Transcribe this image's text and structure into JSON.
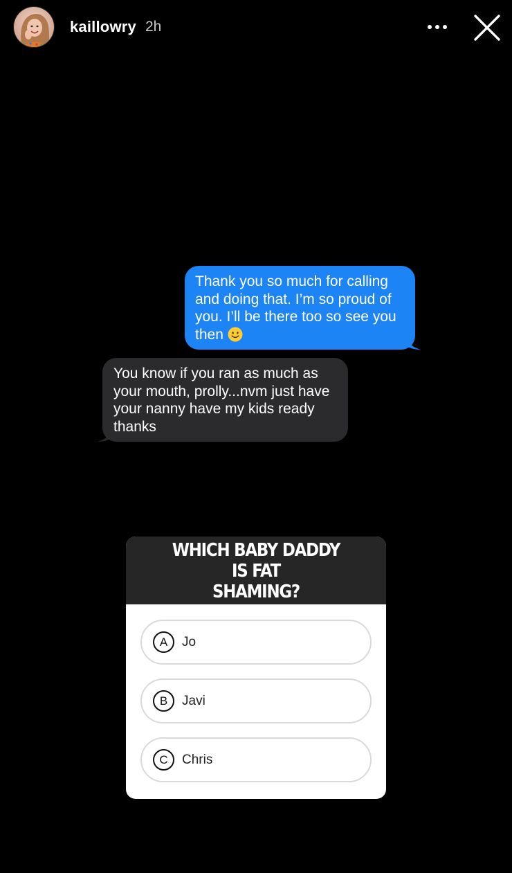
{
  "header": {
    "username": "kaillowry",
    "timestamp": "2h"
  },
  "messages": {
    "sent": {
      "lines": [
        "Thank you so much for calling",
        "and doing that. I’m so proud of",
        "you. I’ll be there too so see you",
        "then"
      ],
      "emoji": "slightly-smiling-face-icon",
      "color": "#1d84f5"
    },
    "received": {
      "lines": [
        "You know if you ran as much as",
        "your mouth, prolly...nvm just have",
        "your nanny have my kids ready",
        "thanks"
      ],
      "color": "#2b2b2d"
    }
  },
  "quiz": {
    "question_lines": [
      "WHICH BABY DADDY IS FAT",
      "SHAMING?"
    ],
    "options": [
      {
        "letter": "A",
        "label": "Jo"
      },
      {
        "letter": "B",
        "label": "Javi"
      },
      {
        "letter": "C",
        "label": "Chris"
      }
    ]
  },
  "icons": {
    "more": "more-horizontal-icon",
    "close": "close-icon"
  }
}
